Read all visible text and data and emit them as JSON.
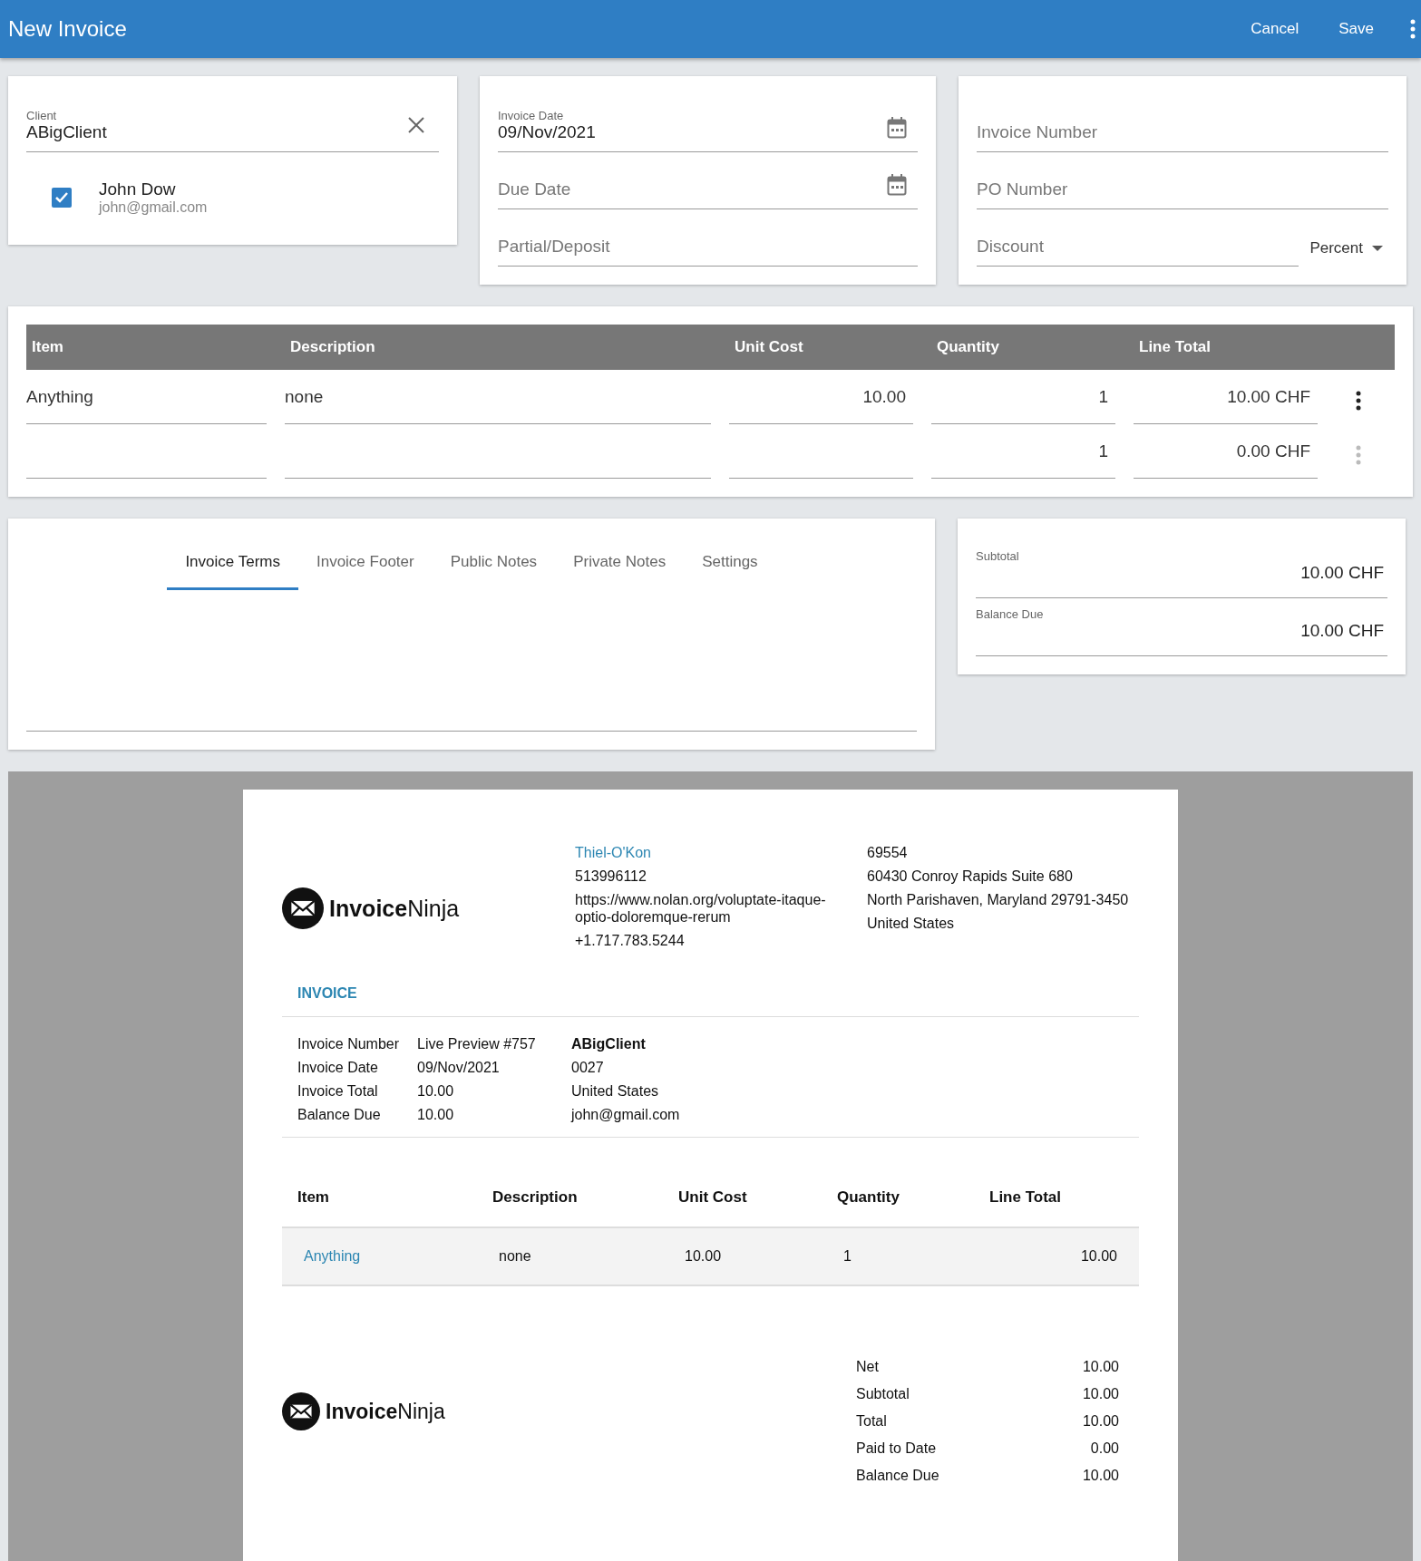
{
  "app_bar": {
    "title": "New Invoice",
    "actions": [
      "Cancel",
      "Save"
    ]
  },
  "client_card": {
    "label": "Client",
    "value": "ABigClient",
    "contacts": [
      {
        "name": "John Dow",
        "email": "john@gmail.com",
        "checked": true
      }
    ]
  },
  "dates_card": {
    "fields": [
      {
        "label": "Invoice Date",
        "value": "09/Nov/2021",
        "calendar": true
      },
      {
        "label": "Due Date",
        "calendar": true
      },
      {
        "label": "Partial/Deposit",
        "calendar": false
      }
    ]
  },
  "numbers_card": {
    "fields": [
      {
        "label": "Invoice Number"
      },
      {
        "label": "PO Number"
      },
      {
        "label": "Discount",
        "select": "Percent"
      }
    ]
  },
  "items_table": {
    "columns": [
      "Item",
      "Description",
      "Unit Cost",
      "Quantity",
      "Line Total"
    ],
    "rows": [
      {
        "cells": [
          "Anything",
          "none",
          "10.00",
          "1",
          "10.00 CHF"
        ],
        "menu_disabled": false
      },
      {
        "cells": [
          "",
          "",
          "",
          "1",
          "0.00 CHF"
        ],
        "menu_disabled": true
      }
    ]
  },
  "notes_tabs": [
    {
      "label": "Invoice Terms",
      "selected": true
    },
    {
      "label": "Invoice Footer",
      "selected": false
    },
    {
      "label": "Public Notes",
      "selected": false
    },
    {
      "label": "Private Notes",
      "selected": false
    },
    {
      "label": "Settings",
      "selected": false
    }
  ],
  "totals_card": [
    {
      "label": "Subtotal",
      "value": "10.00 CHF"
    },
    {
      "label": "Balance Due",
      "value": "10.00 CHF"
    }
  ],
  "preview": {
    "logo": "**Invoice**Ninja",
    "company": [
      "Thiel-O'Kon",
      "513996112",
      "https://www.nolan.org/voluptate-itaque-optio-doloremque-rerum",
      "+1.717.783.5244"
    ],
    "address": [
      "69554",
      "60430 Conroy Rapids Suite 680",
      "North Parishaven, Maryland 29791-3450",
      "United States"
    ],
    "heading": "INVOICE",
    "details": [
      {
        "label": "Invoice Number",
        "value": "Live Preview #757"
      },
      {
        "label": "Invoice Date",
        "value": "09/Nov/2021"
      },
      {
        "label": "Invoice Total",
        "value": "10.00"
      },
      {
        "label": "Balance Due",
        "value": "10.00"
      }
    ],
    "client": [
      "ABigClient",
      "0027",
      "United States",
      "john@gmail.com"
    ],
    "columns": [
      "Item",
      "Description",
      "Unit Cost",
      "Quantity",
      "Line Total"
    ],
    "rows": [
      [
        "Anything",
        "none",
        "10.00",
        "1",
        "10.00"
      ]
    ],
    "footer_logo": "**Invoice**Ninja",
    "totals": [
      {
        "label": "Net",
        "value": "10.00"
      },
      {
        "label": "Subtotal",
        "value": "10.00"
      },
      {
        "label": "Total",
        "value": "10.00"
      },
      {
        "label": "Paid to Date",
        "value": "0.00"
      },
      {
        "label": "Balance Due",
        "value": "10.00"
      }
    ]
  }
}
